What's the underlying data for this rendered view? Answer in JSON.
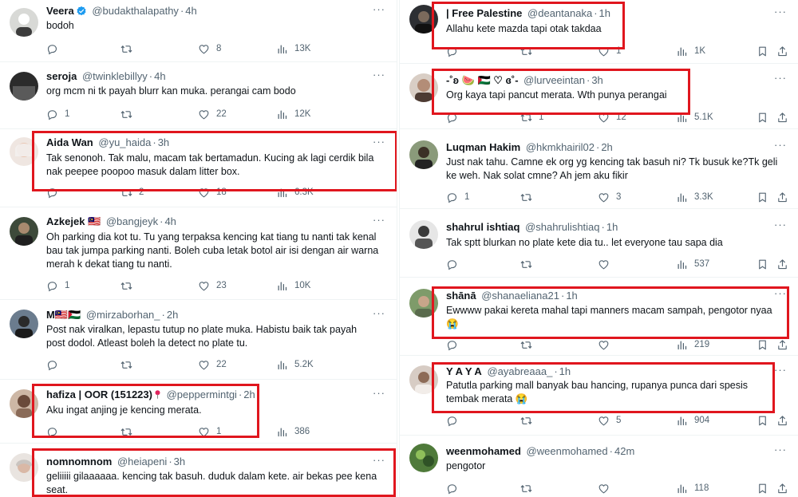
{
  "colors": {
    "highlight": "#e0161e",
    "text": "#0f1419",
    "muted": "#536471",
    "verified": "#1d9bf0",
    "divider": "#eff3f4"
  },
  "icons": {
    "reply": "reply-icon",
    "retweet": "retweet-icon",
    "like": "heart-icon",
    "views": "views-icon",
    "bookmark": "bookmark-icon",
    "share": "share-icon",
    "more": "more-icon"
  },
  "left": [
    {
      "name": "Veera",
      "handle": "@budakthalapathy",
      "time": "4h",
      "verified": true,
      "text": "bodoh",
      "reply": "",
      "retweet": "",
      "like": "8",
      "views": "13K"
    },
    {
      "name": "seroja",
      "handle": "@twinklebillyy",
      "time": "4h",
      "text": "org mcm ni tk payah blurr kan muka. perangai cam bodo",
      "reply": "1",
      "retweet": "",
      "like": "22",
      "views": "12K"
    },
    {
      "name": "Aida Wan",
      "handle": "@yu_haida",
      "time": "3h",
      "text": "Tak senonoh. Tak malu, macam tak bertamadun. Kucing ak lagi cerdik bila\nnak peepee poopoo masuk dalam litter box.",
      "reply": "",
      "retweet": "2",
      "like": "18",
      "views": "6.3K"
    },
    {
      "name": "Azkejek 🇲🇾",
      "handle": "@bangjeyk",
      "time": "4h",
      "text": "Oh parking dia kot tu. Tu yang terpaksa kencing kat tiang tu nanti tak kenal\nbau tak jumpa parking nanti. Boleh cuba letak botol air isi dengan air warna\nmerah k dekat tiang tu nanti.",
      "reply": "1",
      "retweet": "",
      "like": "23",
      "views": "10K"
    },
    {
      "name": "M🇲🇾🇵🇸",
      "handle": "@mirzaborhan_",
      "time": "2h",
      "text": "Post nak viralkan, lepastu tutup no plate muka. Habistu baik tak payah\npost dodol. Atleast boleh la detect no plate tu.",
      "reply": "",
      "retweet": "",
      "like": "22",
      "views": "5.2K"
    },
    {
      "name": "hafiza | OOR (151223)",
      "handle": "@peppermintgi",
      "time": "2h",
      "pin": true,
      "text": "Aku ingat anjing je kencing merata.",
      "reply": "",
      "retweet": "",
      "like": "1",
      "views": "386"
    },
    {
      "name": "nomnomnom",
      "handle": "@heiapeni",
      "time": "3h",
      "text": "geliiiii gilaaaaaa. kencing tak basuh. duduk dalam kete. air bekas pee kena\nseat.",
      "reply": "",
      "retweet": "",
      "like": "",
      "views": ""
    }
  ],
  "right": [
    {
      "name": "| Free Palestine",
      "handle": "@deantanaka",
      "time": "1h",
      "text": "Allahu kete mazda tapi otak takdaa",
      "reply": "",
      "retweet": "",
      "like": "1",
      "views": "1K"
    },
    {
      "name": "-˚ʚ 🍉 🇵🇸 ♡ ɞ˚-",
      "handle": "@lurveeintan",
      "time": "3h",
      "text": "Org kaya tapi pancut merata. Wth punya perangai",
      "reply": "",
      "retweet": "1",
      "like": "12",
      "views": "5.1K"
    },
    {
      "name": "Luqman Hakim",
      "handle": "@hkmkhairil02",
      "time": "2h",
      "text": "Just nak tahu. Camne ek org yg kencing tak basuh ni? Tk busuk ke?Tk geli\nke weh. Nak solat cmne? Ah jem aku fikir",
      "reply": "1",
      "retweet": "",
      "like": "3",
      "views": "3.3K"
    },
    {
      "name": "shahrul ishtiaq",
      "handle": "@shahrulishtiaq",
      "time": "1h",
      "text": "Tak sptt blurkan no plate kete dia tu.. let everyone tau sapa dia",
      "reply": "",
      "retweet": "",
      "like": "",
      "views": "537"
    },
    {
      "name": "shānā",
      "handle": "@shanaeliana21",
      "time": "1h",
      "text": "Ewwww pakai kereta mahal tapi manners macam sampah, pengotor nyaa\n😭",
      "reply": "",
      "retweet": "",
      "like": "",
      "views": "219"
    },
    {
      "name": "Y A Y A",
      "handle": "@ayabreaaa_",
      "time": "1h",
      "text": "Patutla parking mall banyak bau hancing, rupanya punca dari spesis\ntembak merata 😭",
      "reply": "",
      "retweet": "",
      "like": "5",
      "views": "904"
    },
    {
      "name": "weenmohamed",
      "handle": "@weenmohamed",
      "time": "42m",
      "text": "pengotor",
      "reply": "",
      "retweet": "",
      "like": "",
      "views": "118"
    }
  ]
}
